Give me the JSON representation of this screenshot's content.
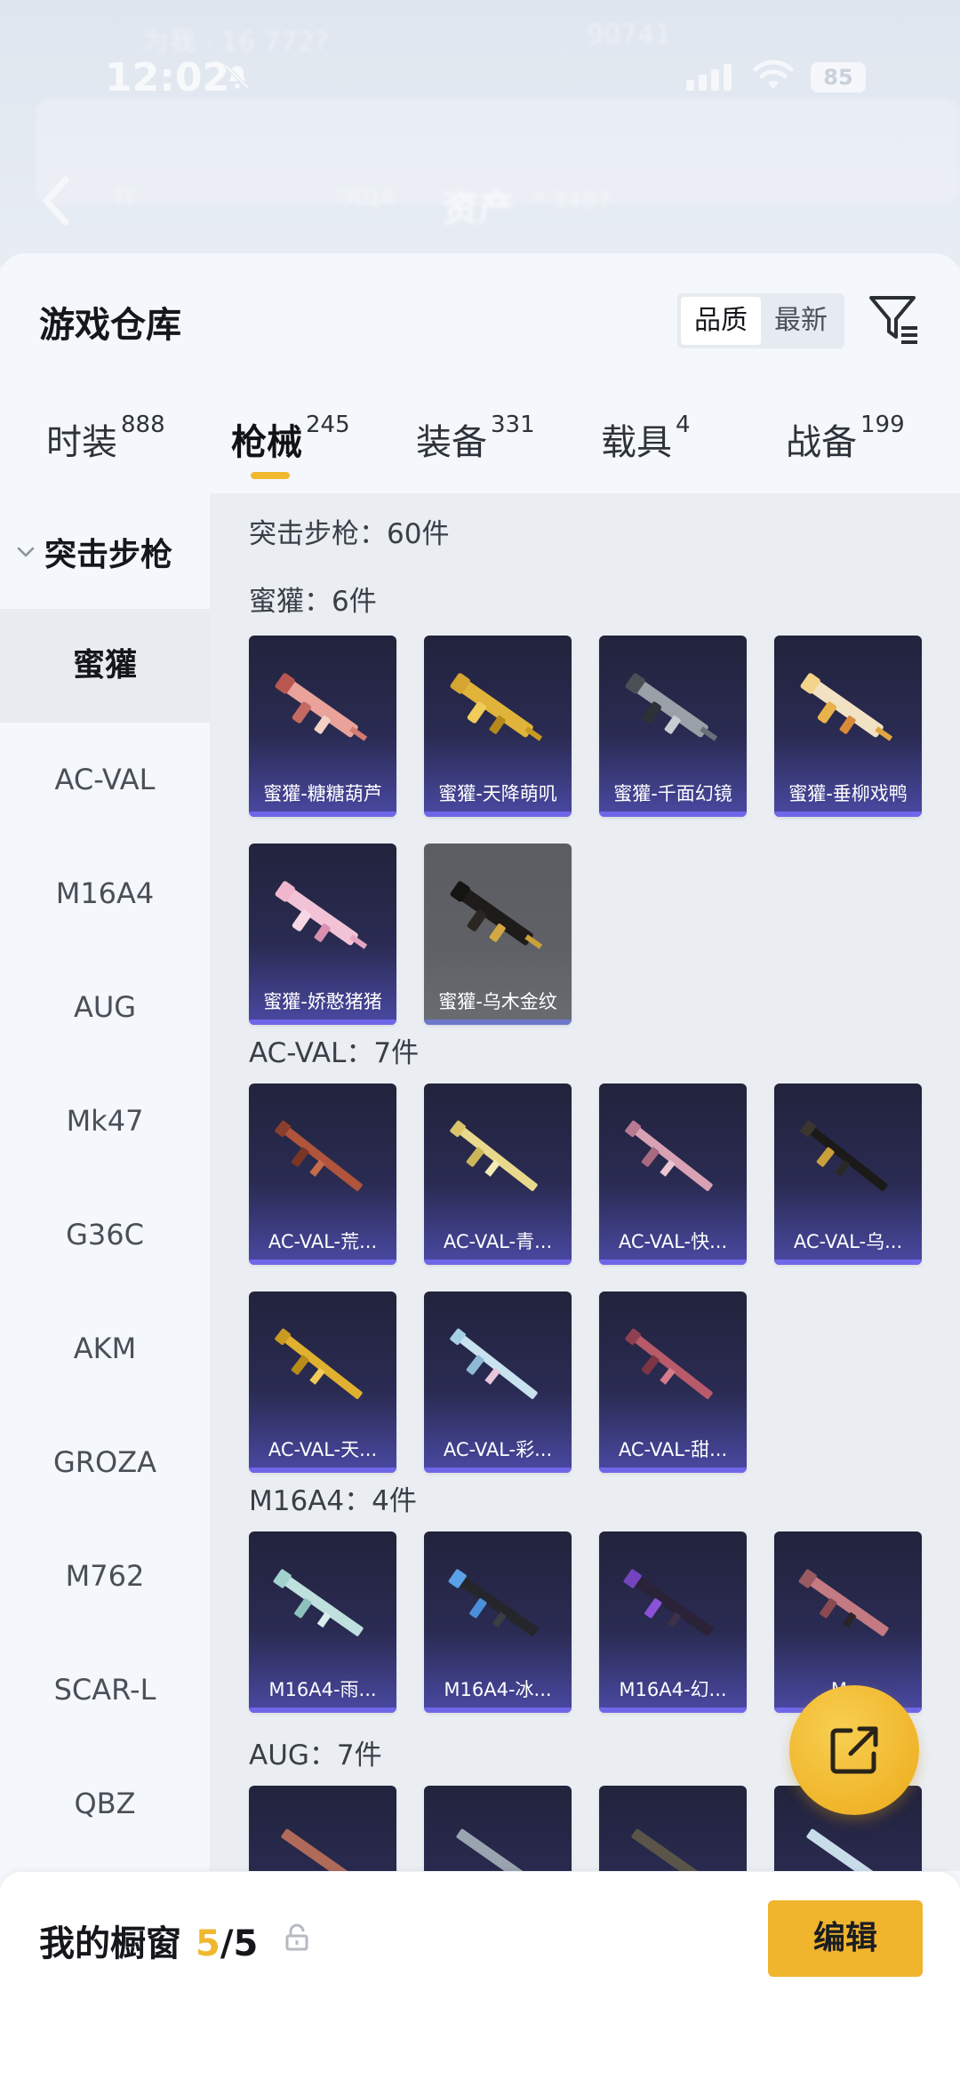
{
  "status_bar": {
    "time": "12:02",
    "battery": "85"
  },
  "bg_header": {
    "faint_left": "为我 · 16 772?",
    "faint_right": "90741",
    "faint_nav": [
      "IT",
      "ЭЩА"
    ],
    "assets_label": "资产",
    "assets_sub": "* 3407"
  },
  "header": {
    "title": "游戏仓库",
    "sort_options": [
      "品质",
      "最新"
    ],
    "sort_active": "品质"
  },
  "tabs": [
    {
      "label": "时装",
      "count": "888"
    },
    {
      "label": "枪械",
      "count": "245",
      "active": true
    },
    {
      "label": "装备",
      "count": "331"
    },
    {
      "label": "载具",
      "count": "4"
    },
    {
      "label": "战备",
      "count": "199"
    }
  ],
  "sidebar": {
    "group": "突击步枪",
    "items": [
      "蜜獾",
      "AC-VAL",
      "M16A4",
      "AUG",
      "Mk47",
      "G36C",
      "AKM",
      "GROZA",
      "M762",
      "SCAR-L",
      "QBZ"
    ],
    "active": "蜜獾"
  },
  "content": {
    "total_line": "突击步枪：60件",
    "sections": [
      {
        "title": "蜜獾：6件",
        "items": [
          "蜜獾-糖糖葫芦",
          "蜜獾-天降萌叽",
          "蜜獾-千面幻镜",
          "蜜獾-垂柳戏鸭",
          "蜜獾-娇憨猪猪",
          "蜜獾-乌木金纹"
        ]
      },
      {
        "title": "AC-VAL：7件",
        "items": [
          "AC-VAL-荒...",
          "AC-VAL-青...",
          "AC-VAL-快...",
          "AC-VAL-乌...",
          "AC-VAL-天...",
          "AC-VAL-彩...",
          "AC-VAL-甜..."
        ]
      },
      {
        "title": "M16A4：4件",
        "items": [
          "M16A4-雨...",
          "M16A4-冰...",
          "M16A4-幻...",
          "M..."
        ]
      },
      {
        "title": "AUG：7件",
        "items": [
          "",
          "",
          "",
          ""
        ]
      }
    ]
  },
  "bottom_bar": {
    "title": "我的橱窗",
    "count_current": "5",
    "count_total": "/5",
    "edit_label": "编辑"
  },
  "colors": {
    "accent": "#f0b82f",
    "card_gradient_top": "#22233c",
    "card_gradient_bottom": "#4a49a4",
    "card_gray": "#5f6166"
  }
}
